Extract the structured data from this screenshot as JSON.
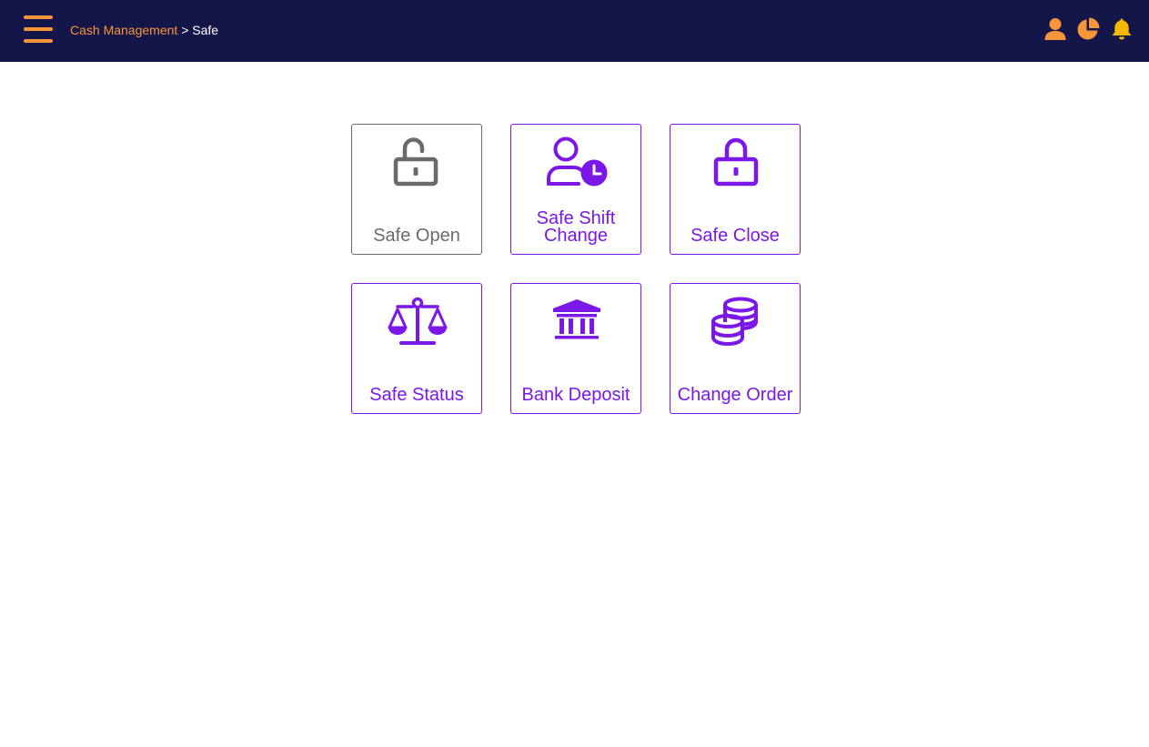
{
  "header": {
    "breadcrumb_parent": "Cash Management",
    "breadcrumb_separator": ">",
    "breadcrumb_current": "Safe",
    "menu_icon": "hamburger-menu-icon",
    "right_icons": [
      "user-icon",
      "pie-chart-icon",
      "bell-icon"
    ]
  },
  "colors": {
    "header_bg": "#141548",
    "accent_orange": "#f7953a",
    "bell_yellow": "#f5b800",
    "tile_purple": "#7b17e8",
    "tile_disabled_gray": "#6a6a6a"
  },
  "tiles": [
    {
      "label": "Safe Open",
      "icon": "unlock-icon",
      "enabled": false
    },
    {
      "label": "Safe Shift Change",
      "icon": "user-clock-icon",
      "enabled": true
    },
    {
      "label": "Safe Close",
      "icon": "lock-icon",
      "enabled": true
    },
    {
      "label": "Safe Status",
      "icon": "scale-balance-icon",
      "enabled": true
    },
    {
      "label": "Bank Deposit",
      "icon": "bank-icon",
      "enabled": true
    },
    {
      "label": "Change Order",
      "icon": "coins-icon",
      "enabled": true
    }
  ]
}
